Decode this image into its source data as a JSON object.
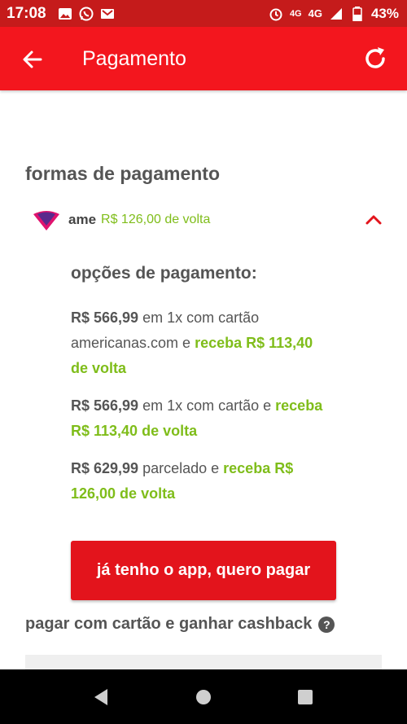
{
  "status_bar": {
    "time": "17:08",
    "network_label_small": "4G",
    "network_label": "4G",
    "battery": "43%"
  },
  "app_bar": {
    "title": "Pagamento"
  },
  "payment": {
    "section_title": "formas de pagamento",
    "ame": {
      "name": "ame",
      "cashback_text": "R$ 126,00 de volta"
    },
    "options_title": "opções de pagamento:",
    "options": [
      {
        "price": "R$ 566,99",
        "mid_text": " em 1x com cartão americanas.com e ",
        "highlight": "receba R$ 113,40 de volta"
      },
      {
        "price": "R$ 566,99",
        "mid_text": " em 1x com cartão e ",
        "highlight": "receba R$ 113,40 de volta"
      },
      {
        "price": "R$ 629,99",
        "mid_text": " parcelado e ",
        "highlight": "receba R$ 126,00 de volta"
      }
    ],
    "primary_button": "já tenho o app, quero pagar",
    "card_cashback_title": "pagar com cartão e ganhar cashback",
    "help_symbol": "?"
  },
  "colors": {
    "status_bar": "#c51b1b",
    "app_bar": "#f3161e",
    "accent_green": "#7fbd1a",
    "button": "#e3141c"
  }
}
